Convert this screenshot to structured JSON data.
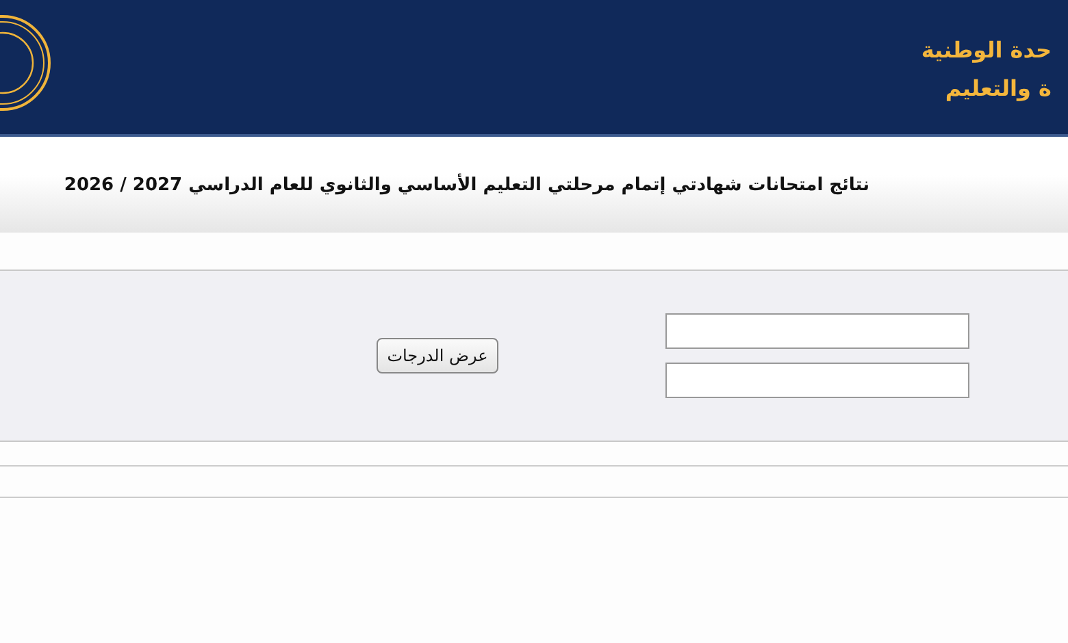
{
  "header": {
    "lines": [
      "حدة الوطنية",
      "ة والتعليم"
    ]
  },
  "title": "نتائج امتحانات شهادتي إتمام مرحلتي التعليم الأساسي والثانوي للعام الدراسي  2027 / 2026",
  "form": {
    "fields": [
      {
        "kind": "text"
      },
      {
        "kind": "text"
      }
    ],
    "button": "عرض الدرجات"
  }
}
